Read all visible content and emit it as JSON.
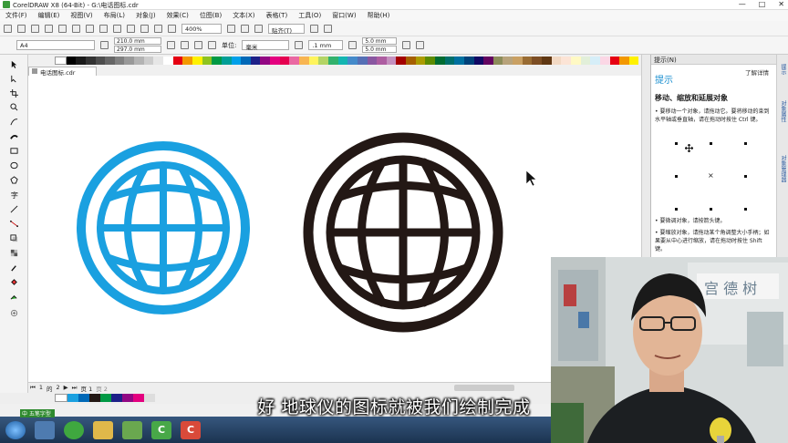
{
  "window": {
    "title": "CorelDRAW X8 (64-Bit) - G:\\电话图标.cdr",
    "min": "—",
    "restore": "□",
    "close": "✕"
  },
  "menu": [
    "文件(F)",
    "编辑(E)",
    "视图(V)",
    "布局(L)",
    "对象(J)",
    "效果(C)",
    "位图(B)",
    "文本(X)",
    "表格(T)",
    "工具(O)",
    "窗口(W)",
    "帮助(H)"
  ],
  "toolbar": {
    "zoom": "400%",
    "snap": "贴齐(T)"
  },
  "propbar": {
    "page_size": "A4",
    "width": "210.0 mm",
    "height": "297.0 mm",
    "units_label": "单位:",
    "units": "毫米",
    "nudge": ".1 mm",
    "dup_x": "5.0 mm",
    "dup_y": "5.0 mm"
  },
  "document_tab": "电话图标.cdr",
  "pages": {
    "current": "1",
    "of": "的",
    "total": "2",
    "page1": "页 1",
    "page2": "页 2"
  },
  "hints_panel": {
    "header": "提示(N)",
    "title": "提示",
    "learn_more": "了解详情",
    "heading": "移动、缩放和延展对象",
    "p1": "• 要移动一个对象，请拖动它。要将移动的束到水平轴或垂直轴，请在拖动时按住 Ctrl 键。",
    "p2": "• 要微调对象，请按箭头键。",
    "p3": "• 要缩放对象，请拖动某个角调整大小手柄；如果要从中心进行缩放，请在拖动时按住 Shift 键。",
    "center_mark": "×"
  },
  "dockers": [
    "提示",
    "对象属性",
    "对象管理器"
  ],
  "ime": "中 五笔字型",
  "subtitle": "好 地球仪的图标就被我们绘制完成",
  "colors": {
    "blue_globe": "#1aa0e0",
    "black_globe": "#231815",
    "accent_blue": "#1a8fd0"
  },
  "icons": {
    "pick_tool": "arrow-icon",
    "cursor": "arrow-cursor-icon",
    "move_handle": "move-icon"
  },
  "taskbar": {
    "corel_c1": "C",
    "corel_c2": "C"
  }
}
